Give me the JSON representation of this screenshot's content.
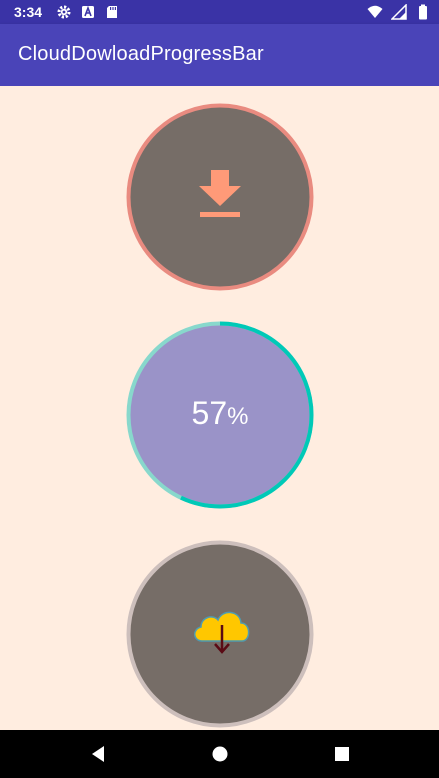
{
  "status_bar": {
    "time": "3:34",
    "left_icons": [
      "gear-icon",
      "a-box-icon",
      "sd-card-icon"
    ],
    "right_icons": [
      "wifi-icon",
      "signal-icon",
      "battery-icon"
    ],
    "background": "#3a33a6"
  },
  "app_bar": {
    "title": "CloudDowloadProgressBar",
    "background": "#4a44b8"
  },
  "content": {
    "background": "#ffede0",
    "button_idle": {
      "icon": "download-arrow-icon",
      "fill": "#766d67",
      "ring": "#e98b80",
      "icon_color": "#ff9a78"
    },
    "button_progress": {
      "percent_value": "57",
      "percent_sign": "%",
      "progress": 0.57,
      "fill": "#9a93c8",
      "ring_track": "#88d8cc",
      "ring_progress": "#00c9b7"
    },
    "button_cloud": {
      "icon": "cloud-download-icon",
      "fill": "#766d67",
      "ring": "#cdbfbc",
      "cloud_color": "#ffc700",
      "arrow_color": "#5a0a14"
    }
  },
  "nav_bar": {
    "items": [
      "back-icon",
      "home-icon",
      "recents-icon"
    ]
  }
}
